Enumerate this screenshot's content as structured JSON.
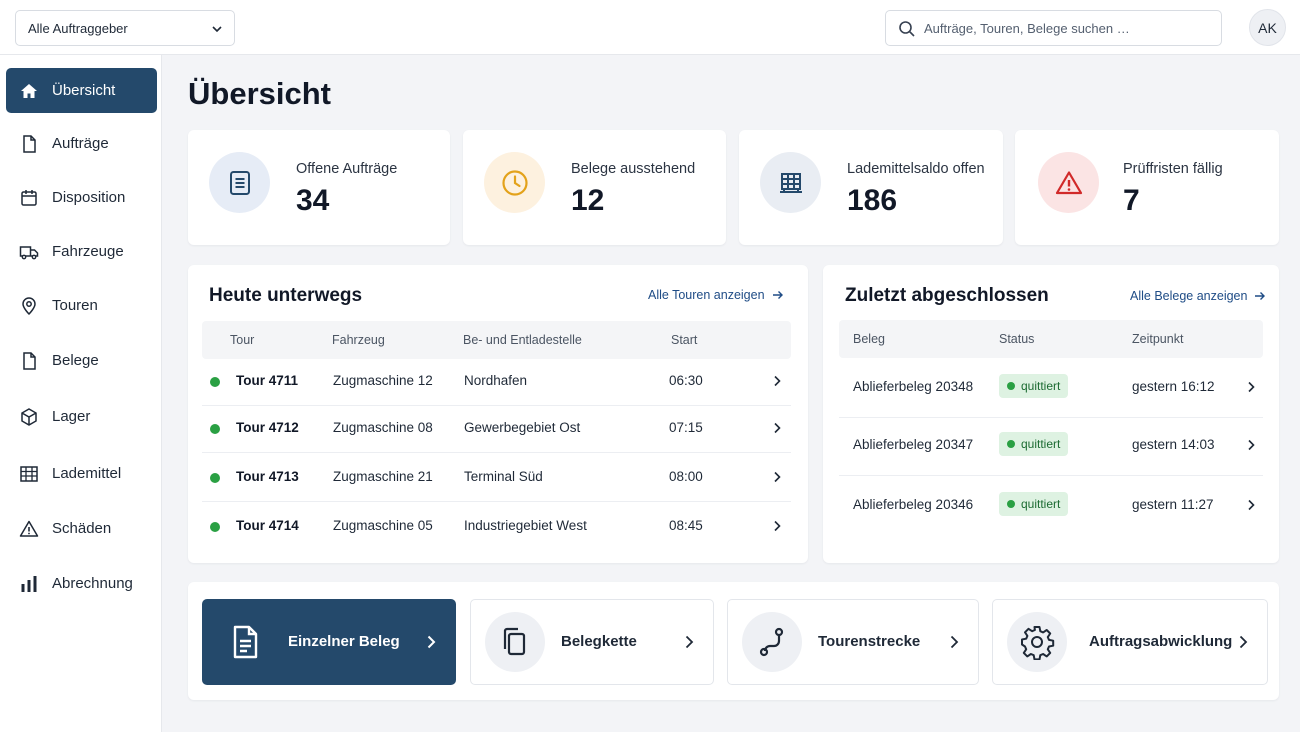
{
  "topbar": {
    "client_select": "Alle Auftraggeber",
    "search_placeholder": "Aufträge, Touren, Belege suchen …",
    "avatar_initials": "AK"
  },
  "sidebar": {
    "items": [
      {
        "label": "Übersicht",
        "icon": "home-icon",
        "active": true
      },
      {
        "label": "Aufträge",
        "icon": "document-icon"
      },
      {
        "label": "Disposition",
        "icon": "calendar-icon"
      },
      {
        "label": "Fahrzeuge",
        "icon": "truck-icon"
      },
      {
        "label": "Touren",
        "icon": "map-pin-icon"
      },
      {
        "label": "Belege",
        "icon": "file-icon"
      },
      {
        "label": "Lager",
        "icon": "box-icon"
      },
      {
        "label": "Lademittel",
        "icon": "pallet-icon"
      },
      {
        "label": "Schäden",
        "icon": "warning-icon"
      },
      {
        "label": "Abrechnung",
        "icon": "bar-chart-icon"
      }
    ]
  },
  "page": {
    "title": "Übersicht"
  },
  "stats": [
    {
      "label": "Offene Aufträge",
      "value": "34",
      "icon": "document-icon",
      "color": "#e6ecf6"
    },
    {
      "label": "Belege ausstehend",
      "value": "12",
      "icon": "clock-icon",
      "color": "#fdf1df"
    },
    {
      "label": "Lademittelsaldo offen",
      "value": "186",
      "icon": "pallet-icon",
      "color": "#e9edf3"
    },
    {
      "label": "Prüffristen fällig",
      "value": "7",
      "icon": "warning-icon",
      "color": "#fbe4e4"
    }
  ],
  "tours": {
    "title": "Heute unterwegs",
    "link": "Alle Touren anzeigen",
    "columns": [
      "Tour",
      "Fahrzeug",
      "Be- und Entladestelle",
      "Start"
    ],
    "rows": [
      {
        "tour": "Tour 4711",
        "vehicle": "Zugmaschine 12",
        "place": "Nordhafen",
        "start": "06:30"
      },
      {
        "tour": "Tour 4712",
        "vehicle": "Zugmaschine 08",
        "place": "Gewerbegebiet Ost",
        "start": "07:15"
      },
      {
        "tour": "Tour 4713",
        "vehicle": "Zugmaschine 21",
        "place": "Terminal Süd",
        "start": "08:00"
      },
      {
        "tour": "Tour 4714",
        "vehicle": "Zugmaschine 05",
        "place": "Industriegebiet West",
        "start": "08:45"
      }
    ]
  },
  "recent": {
    "title": "Zuletzt abgeschlossen",
    "link": "Alle Belege anzeigen",
    "columns": [
      "Beleg",
      "Status",
      "Zeitpunkt"
    ],
    "rows": [
      {
        "doc": "Ablieferbeleg 20348",
        "status": "quittiert",
        "time": "gestern 16:12"
      },
      {
        "doc": "Ablieferbeleg 20347",
        "status": "quittiert",
        "time": "gestern 14:03"
      },
      {
        "doc": "Ablieferbeleg 20346",
        "status": "quittiert",
        "time": "gestern 11:27"
      }
    ]
  },
  "actions": [
    {
      "label": "Einzelner Beleg",
      "icon": "document-icon",
      "primary": true
    },
    {
      "label": "Belegkette",
      "icon": "copy-icon"
    },
    {
      "label": "Tourenstrecke",
      "icon": "route-icon"
    },
    {
      "label": "Auftragsabwicklung",
      "icon": "gear-icon"
    }
  ],
  "colors": {
    "accent": "#24496b",
    "link": "#1f4c86",
    "status_ok": "#2aa043"
  }
}
